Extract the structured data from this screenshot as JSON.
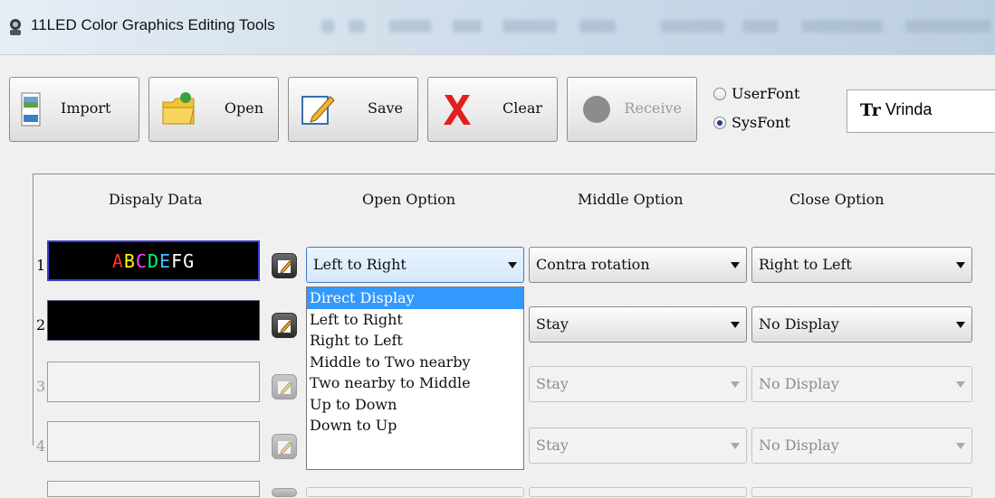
{
  "window": {
    "title": "11LED Color Graphics Editing Tools"
  },
  "toolbar": {
    "import_label": "Import",
    "open_label": "Open",
    "save_label": "Save",
    "clear_label": "Clear",
    "receive_label": "Receive"
  },
  "font_source": {
    "userfont_label": "UserFont",
    "sysfont_label": "SysFont",
    "selected": "SysFont"
  },
  "font_selector": {
    "glyph": "Tr",
    "value": "Vrinda"
  },
  "columns": {
    "display": "Dispaly Data",
    "open": "Open Option",
    "middle": "Middle Option",
    "close": "Close Option"
  },
  "rows": [
    {
      "num": "1",
      "text": "ABCDEFG",
      "open": "Left to Right",
      "middle": "Contra rotation",
      "close": "Right to Left",
      "enabled": true
    },
    {
      "num": "2",
      "text": "",
      "open": "",
      "middle": "Stay",
      "close": "No Display",
      "enabled": true
    },
    {
      "num": "3",
      "text": "",
      "open": "",
      "middle": "Stay",
      "close": "No Display",
      "enabled": false
    },
    {
      "num": "4",
      "text": "",
      "open": "",
      "middle": "Stay",
      "close": "No Display",
      "enabled": false
    }
  ],
  "row1_text_colors": [
    "#ff3030",
    "#ffff00",
    "#ff40ff",
    "#00ff66",
    "#40c0ff",
    "#ffffff",
    "#ffffff"
  ],
  "open_dropdown": {
    "options": [
      "Direct Display",
      "Left to Right",
      "Right to Left",
      "Middle to Two nearby",
      "Two nearby to Middle",
      "Up to Down",
      "Down to Up"
    ],
    "highlighted": "Direct Display"
  },
  "colors": {
    "highlight": "#3399ff",
    "active_border": "#3d7bcc"
  }
}
